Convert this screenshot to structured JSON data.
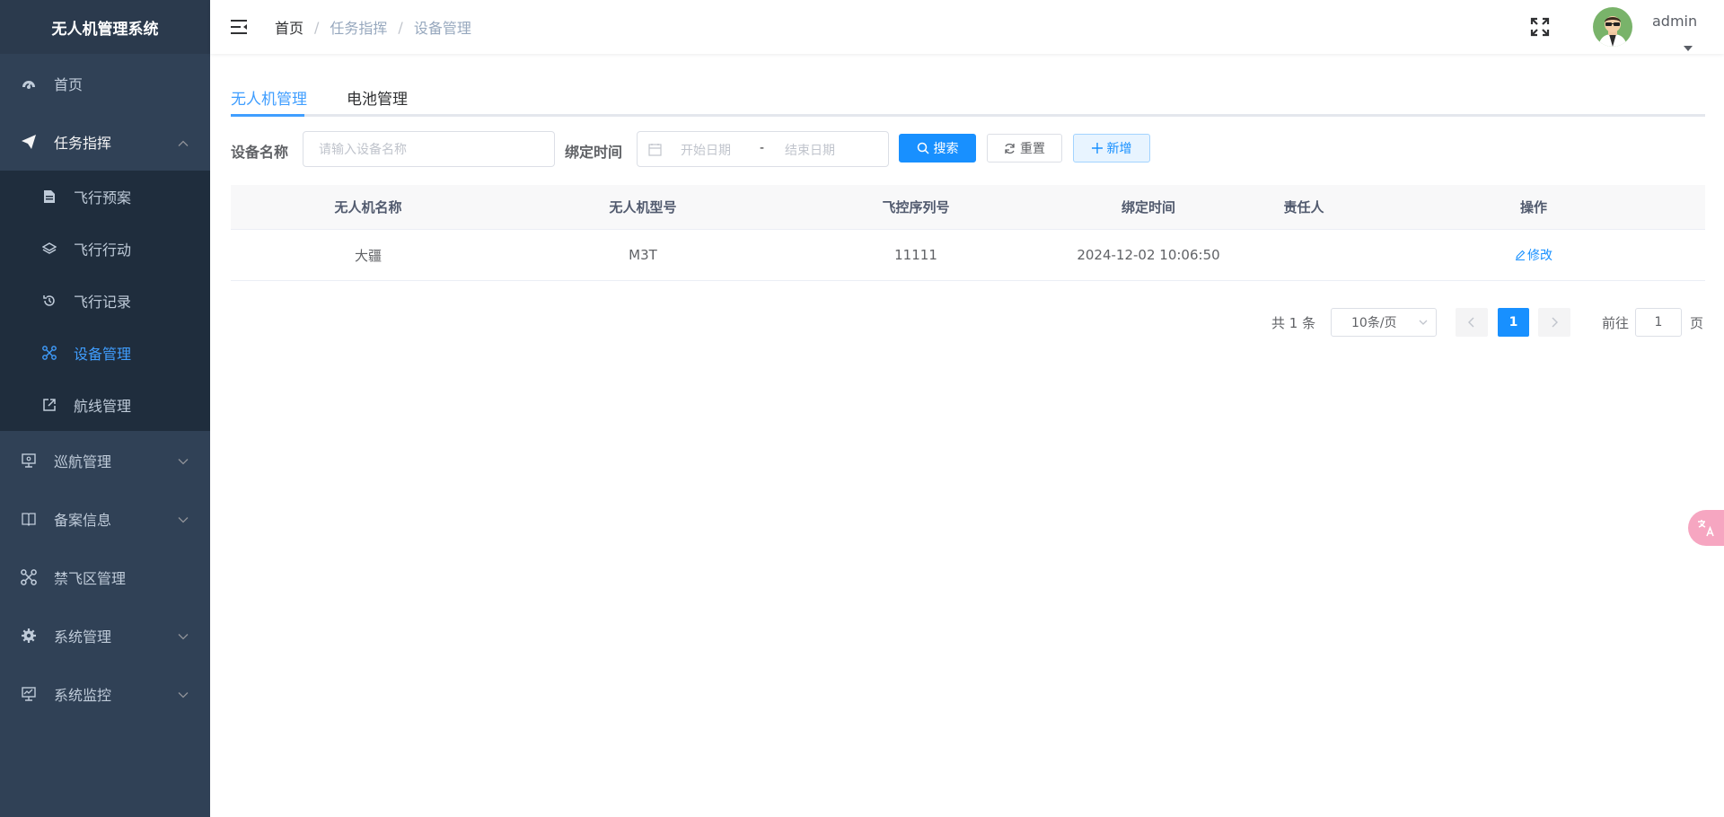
{
  "app": {
    "title": "无人机管理系统"
  },
  "sidebar": {
    "items": [
      {
        "label": "首页",
        "icon": "dashboard-icon"
      },
      {
        "label": "任务指挥",
        "icon": "send-icon",
        "expanded": true,
        "children": [
          {
            "label": "飞行预案",
            "icon": "document-icon"
          },
          {
            "label": "飞行行动",
            "icon": "layers-icon"
          },
          {
            "label": "飞行记录",
            "icon": "history-icon"
          },
          {
            "label": "设备管理",
            "icon": "drone-icon",
            "active": true
          },
          {
            "label": "航线管理",
            "icon": "external-link-icon"
          }
        ]
      },
      {
        "label": "巡航管理",
        "icon": "monitor-icon"
      },
      {
        "label": "备案信息",
        "icon": "book-icon"
      },
      {
        "label": "禁飞区管理",
        "icon": "drone-icon"
      },
      {
        "label": "系统管理",
        "icon": "gear-icon"
      },
      {
        "label": "系统监控",
        "icon": "monitor-chart-icon"
      }
    ]
  },
  "header": {
    "breadcrumb": [
      "首页",
      "任务指挥",
      "设备管理"
    ],
    "username": "admin"
  },
  "tabs": [
    {
      "label": "无人机管理",
      "active": true
    },
    {
      "label": "电池管理",
      "active": false
    }
  ],
  "filter": {
    "device_name_label": "设备名称",
    "device_name_placeholder": "请输入设备名称",
    "bind_time_label": "绑定时间",
    "start_placeholder": "开始日期",
    "range_sep": "-",
    "end_placeholder": "结束日期",
    "search_label": "搜索",
    "reset_label": "重置",
    "add_label": "新增"
  },
  "table": {
    "columns": [
      "无人机名称",
      "无人机型号",
      "飞控序列号",
      "绑定时间",
      "责任人",
      "操作"
    ],
    "rows": [
      {
        "name": "大疆",
        "model": "M3T",
        "serial": "11111",
        "bind_time": "2024-12-02 10:06:50",
        "owner": "",
        "action": "修改"
      }
    ]
  },
  "pagination": {
    "total_text": "共 1 条",
    "page_size": "10条/页",
    "current_page": "1",
    "goto_label": "前往",
    "goto_value": "1",
    "page_suffix": "页"
  },
  "colors": {
    "sidebar_bg": "#304156",
    "submenu_bg": "#1f2d3d",
    "accent": "#1890ff",
    "active_menu": "#409eff"
  }
}
